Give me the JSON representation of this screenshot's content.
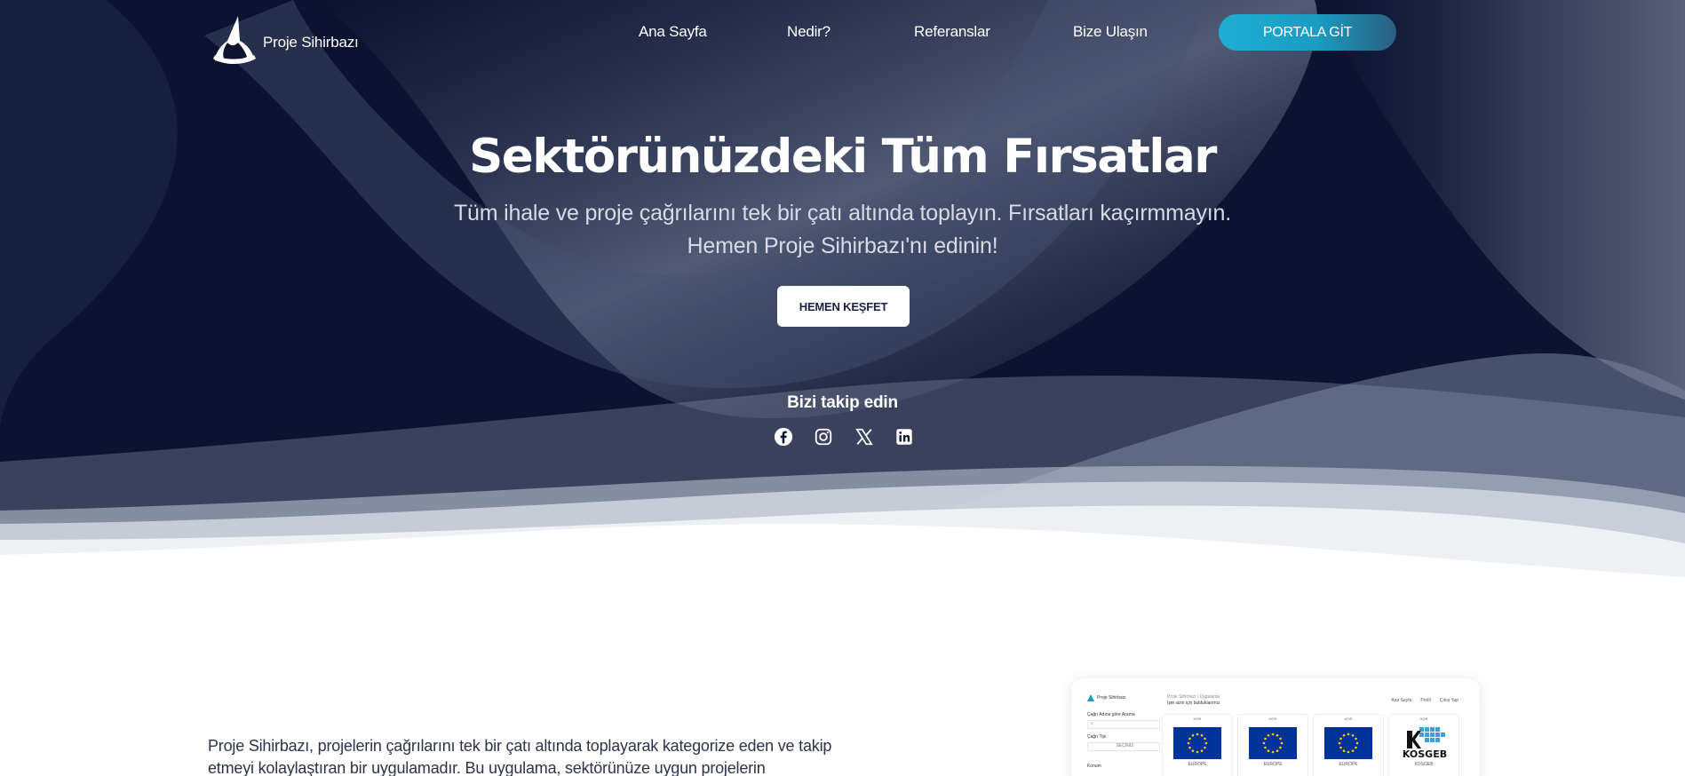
{
  "brand": {
    "name": "Proje Sihirbazı"
  },
  "nav": {
    "items": [
      {
        "label": "Ana Sayfa"
      },
      {
        "label": "Nedir?"
      },
      {
        "label": "Referanslar"
      },
      {
        "label": "Bize Ulaşın"
      }
    ],
    "portal_button": "PORTALA GİT"
  },
  "hero": {
    "title": "Sektörünüzdeki Tüm Fırsatlar",
    "subtitle": "Tüm ihale ve proje çağrılarını tek bir çatı altında toplayın. Fırsatları kaçırmmayın. Hemen Proje Sihirbazı'nı edinin!",
    "cta": "HEMEN KEŞFET",
    "follow_title": "Bizi takip edin",
    "social_icons": [
      "facebook-icon",
      "instagram-icon",
      "x-twitter-icon",
      "linkedin-icon"
    ]
  },
  "about": {
    "text": "Proje Sihirbazı, projelerin çağrılarını tek bir çatı altında toplayarak kategorize eden ve takip etmeyi kolaylaştıran bir uygulamadır. Bu uygulama, sektörünüze uygun projelerin"
  },
  "preview": {
    "app_name": "Proje Sihirbazı",
    "search_label": "Çağrı Adına göre Arama",
    "type_label": "Çağrı Tipi",
    "type_value": "SEÇİNİZ",
    "location_label": "Konum",
    "crumb": "Proje Sihirbazı / Uygulama",
    "crumb_title": "İşte sizin için bulduklarımız",
    "top_links": [
      "Ana Sayfa",
      "Profil",
      "Çıkış Yap"
    ],
    "cards": [
      {
        "tag": "HOR",
        "name": "EUROPE"
      },
      {
        "tag": "HOR",
        "name": "EUROPE"
      },
      {
        "tag": "HOR",
        "name": "EUROPE"
      },
      {
        "tag": "HOR",
        "name": "KOSGEB"
      }
    ],
    "kosgeb_logo_text": "KOSGEB"
  },
  "colors": {
    "hero_bg": "#0c1430",
    "portal_gradient_start": "#1eaed3",
    "portal_gradient_end": "#2a5f7e",
    "text_dark": "#2d3348"
  }
}
